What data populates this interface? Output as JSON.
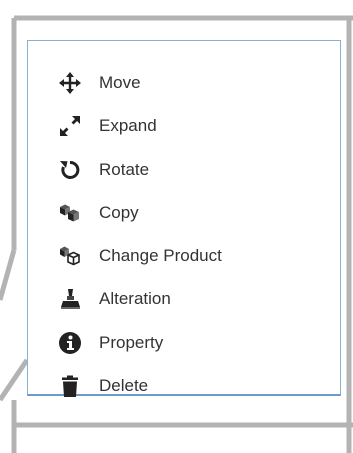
{
  "context_menu": {
    "items": [
      {
        "label": "Move",
        "icon": "move-arrows-icon"
      },
      {
        "label": "Expand",
        "icon": "expand-arrows-icon"
      },
      {
        "label": "Rotate",
        "icon": "rotate-icon"
      },
      {
        "label": "Copy",
        "icon": "copy-cubes-icon"
      },
      {
        "label": "Change Product",
        "icon": "change-product-icon"
      },
      {
        "label": "Alteration",
        "icon": "alteration-icon"
      },
      {
        "label": "Property",
        "icon": "info-icon"
      },
      {
        "label": "Delete",
        "icon": "trash-icon"
      }
    ]
  },
  "colors": {
    "menu_border": "#87b0d6",
    "icon": "#222222",
    "label_text": "#333333",
    "callout_lines": "#b0b0b0"
  }
}
